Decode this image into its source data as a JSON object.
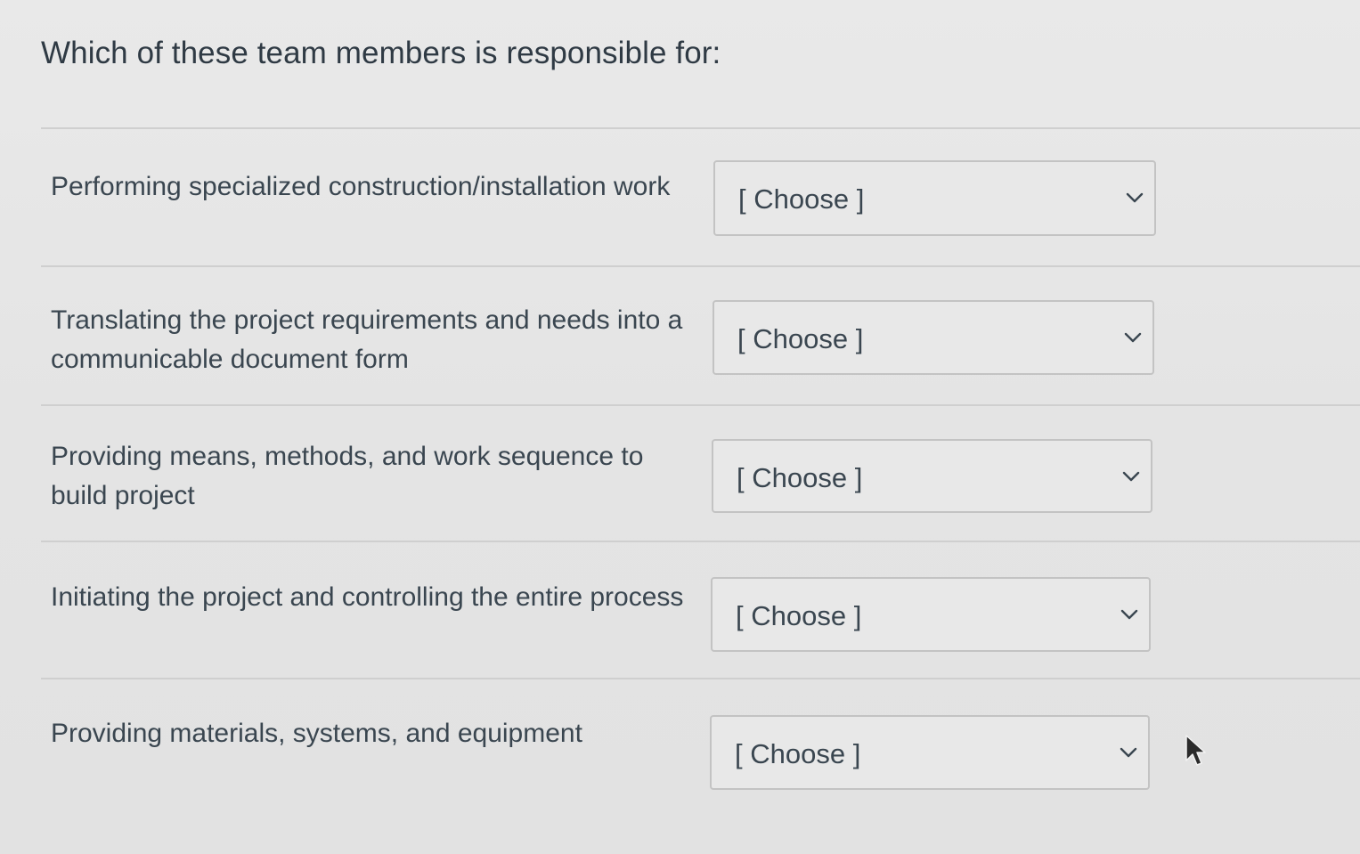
{
  "question": {
    "text": "Which of these team members is responsible for:"
  },
  "items": [
    {
      "prompt": "Performing specialized construction/installation work",
      "select_value": "[ Choose ]"
    },
    {
      "prompt": "Translating the project requirements and needs into a communicable document form",
      "select_value": "[ Choose ]"
    },
    {
      "prompt": "Providing means, methods, and work sequence to build project",
      "select_value": "[ Choose ]"
    },
    {
      "prompt": "Initiating the project and controlling the entire process",
      "select_value": "[ Choose ]"
    },
    {
      "prompt": "Providing materials, systems, and equipment",
      "select_value": "[ Choose ]"
    }
  ],
  "icons": {
    "dropdown": "chevron-down-icon",
    "pointer": "mouse-pointer-icon"
  },
  "colors": {
    "text": "#2f3a44",
    "border": "#c3c3c3",
    "background": "#e6e6e6"
  }
}
